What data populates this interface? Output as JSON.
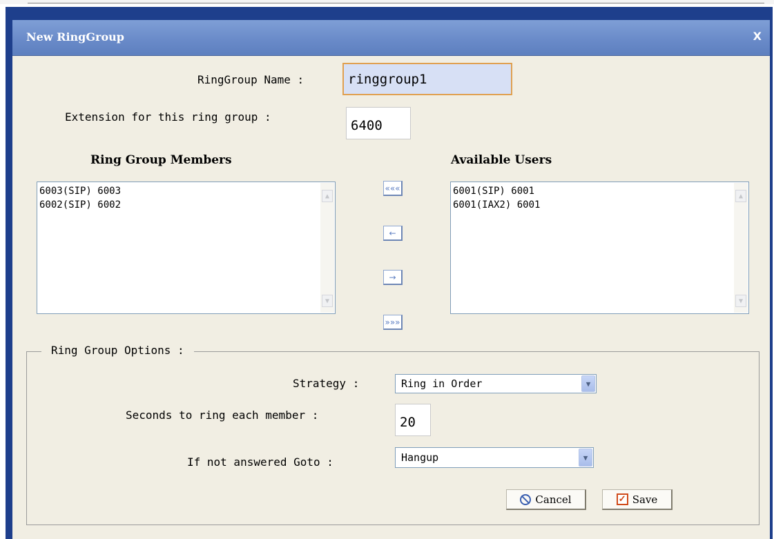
{
  "dialog": {
    "title": "New RingGroup",
    "close_label": "X"
  },
  "form": {
    "name_label": "RingGroup Name :",
    "name_value": "ringgroup1",
    "extension_label": "Extension for this ring group :",
    "extension_value": "6400"
  },
  "members": {
    "heading": "Ring Group Members",
    "items": [
      "6003(SIP) 6003",
      "6002(SIP) 6002"
    ]
  },
  "available": {
    "heading": "Available Users",
    "items": [
      "6001(SIP) 6001",
      "6001(IAX2) 6001"
    ]
  },
  "move_buttons": {
    "add_all": "«««",
    "add_one": "←",
    "remove_one": "→",
    "remove_all": "»»»"
  },
  "options": {
    "legend": "Ring Group Options :",
    "strategy_label": "Strategy :",
    "strategy_value": "Ring in Order",
    "seconds_label": "Seconds to ring each member :",
    "seconds_value": "20",
    "goto_label": "If not answered Goto :",
    "goto_value": "Hangup"
  },
  "actions": {
    "cancel_label": "Cancel",
    "save_label": "Save"
  },
  "icons": {
    "scroll_up": "▲",
    "scroll_down": "▼",
    "dropdown": "▼",
    "checkmark": "✓"
  },
  "colors": {
    "titlebar": "#6a8bc9",
    "dialog_bg": "#f1eee3",
    "frame": "#1e3f8c",
    "focus_border": "#e0a050"
  }
}
